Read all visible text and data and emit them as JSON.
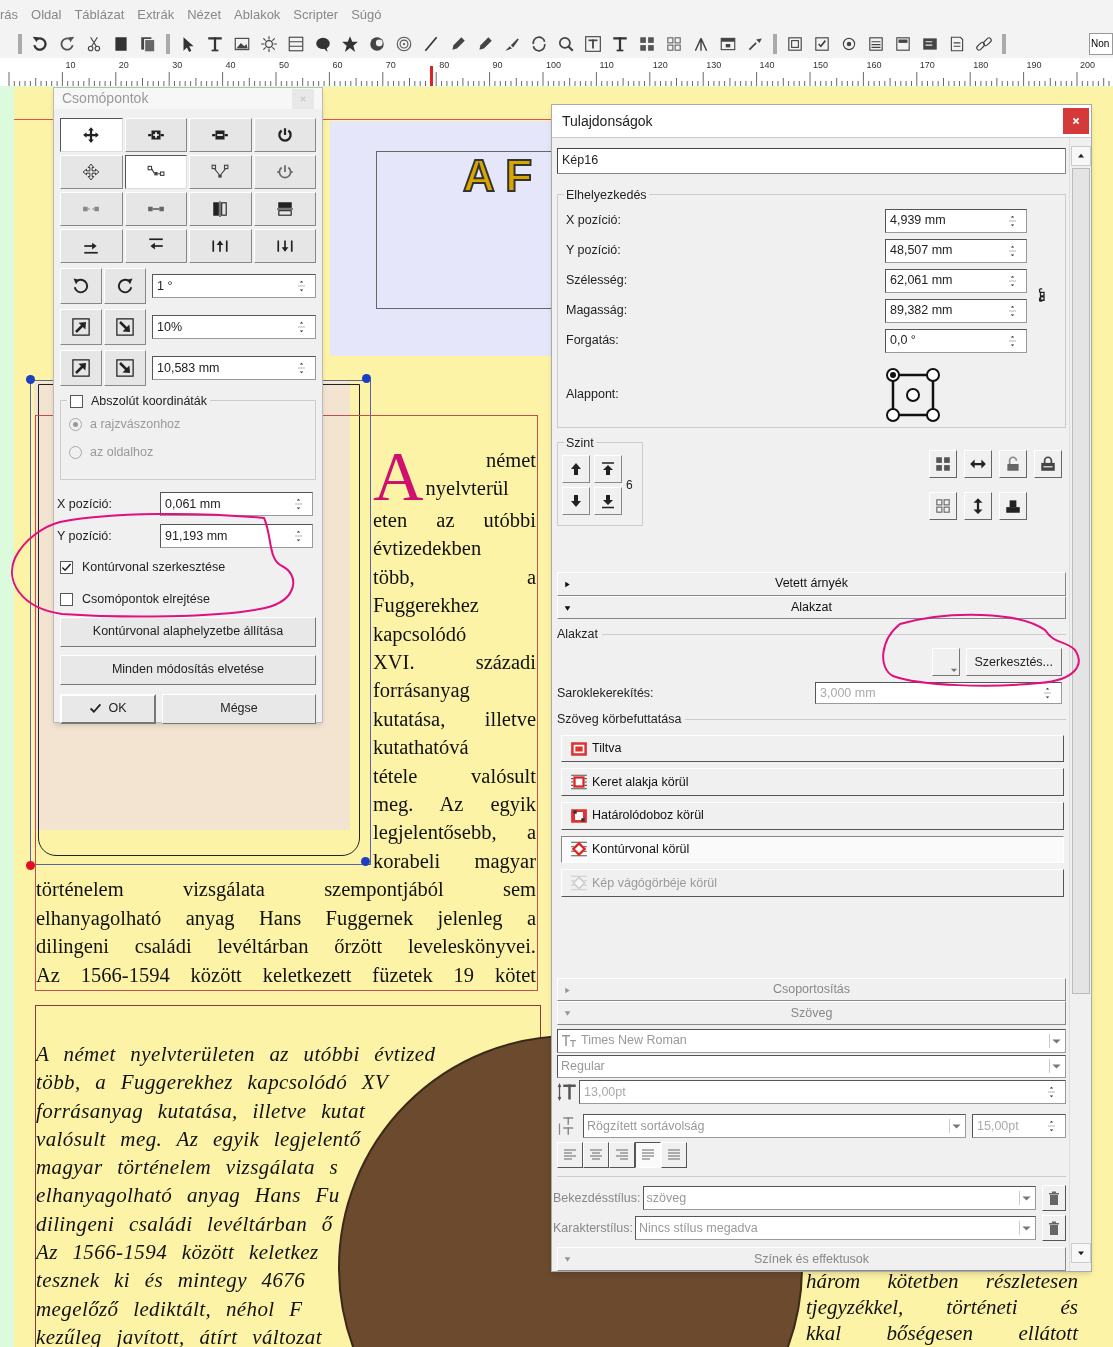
{
  "menu": [
    "rás",
    "Oldal",
    "Táblázat",
    "Extrák",
    "Nézet",
    "Ablakok",
    "Scripter",
    "Súgó"
  ],
  "toolbar_field": "Non",
  "ruler": [
    "10",
    "20",
    "30",
    "40",
    "50",
    "60",
    "70",
    "80",
    "90",
    "100",
    "110",
    "120",
    "130",
    "140",
    "150",
    "160",
    "170",
    "180",
    "190",
    "200"
  ],
  "document": {
    "header_title": "A F",
    "drop_cap": "A",
    "column_lines": [
      "német",
      "nyelvterül",
      "eten az utóbbi",
      "évtizedekben",
      "több, a",
      "Fuggerekhez",
      "kapcsolódó",
      "XVI. századi",
      "forrásanyag",
      "kutatása, illetve",
      "kutathatóvá",
      "tétele valósult",
      "meg. Az egyik",
      "legjelentősebb, a",
      "korabeli magyar"
    ],
    "full_lines": [
      "történelem vizsgálata szempontjából sem",
      "elhanyagolható anyag Hans Fuggernek jelenleg a",
      "dilingeni családi levéltárban őrzött leveleskönyvei.",
      "Az 1566-1594 között keletkezett füzetek 19 kötet"
    ],
    "italic_lines": [
      "A német nyelvterületen az utóbbi évtized",
      "több, a Fuggerekhez kapcsolódó XV",
      "forrásanyag kutatása, illetve kutat",
      "valósult meg. Az egyik legjelentő",
      "magyar történelem vizsgálata s",
      "elhanyagolható anyag Hans Fu",
      "dilingeni családi levéltárban ő",
      "Az 1566-1594 között keletkez",
      "tesznek ki és mintegy 4676",
      "megelőző lediktált, néhol F",
      "kezűleg javított, átírt változat"
    ],
    "right_lines": [
      "három kötetben részletesen",
      "tjegyzékkel, történeti és",
      "kkal bőségesen ellátott"
    ]
  },
  "nodes_dialog": {
    "title": "Csomópontok",
    "tools": [
      {
        "selected": true
      },
      {
        "selected": false
      },
      {
        "selected": false
      },
      {
        "selected": false
      },
      {
        "selected": false
      },
      {
        "selected": true
      },
      {
        "selected": false
      },
      {
        "selected": false
      },
      {
        "selected": false
      },
      {
        "selected": false
      },
      {
        "selected": false
      },
      {
        "selected": false
      },
      {
        "selected": false
      },
      {
        "selected": false
      },
      {
        "selected": false
      },
      {
        "selected": false
      }
    ],
    "rotate": "1 °",
    "scale_percent": "10%",
    "scale_length": "10,583 mm",
    "absolute": {
      "label": "Abszolút koordináták",
      "checked": false
    },
    "origin": [
      {
        "label": "a rajzvászonhoz",
        "selected": true,
        "disabled": true
      },
      {
        "label": "az oldalhoz",
        "selected": false,
        "disabled": true
      }
    ],
    "x": {
      "label": "X pozíció:",
      "value": "0,061 mm"
    },
    "y": {
      "label": "Y pozíció:",
      "value": "91,193 mm"
    },
    "options": [
      {
        "label": "Kontúrvonal szerkesztése",
        "checked": true
      },
      {
        "label": "Csomópontok elrejtése",
        "checked": false
      }
    ],
    "buttons": [
      {
        "label": "Kontúrvonal alaphelyzetbe állítása",
        "kind": "wide"
      },
      {
        "label": "Minden módosítás elvetése",
        "kind": "wide"
      },
      {
        "label": "OK",
        "kind": "ok"
      },
      {
        "label": "Mégse",
        "kind": "cancel"
      }
    ]
  },
  "properties": {
    "title": "Tulajdonságok",
    "name": "Kép16",
    "placement": {
      "title": "Elhelyezkedés",
      "fields": [
        {
          "label": "X pozíció:",
          "value": "4,939 mm"
        },
        {
          "label": "Y pozíció:",
          "value": "48,507 mm"
        },
        {
          "label": "Szélesség:",
          "value": "62,061 mm"
        },
        {
          "label": "Magasság:",
          "value": "89,382 mm"
        },
        {
          "label": "Forgatás:",
          "value": "0,0 °"
        }
      ],
      "anchor_label": "Alappont:",
      "anchor_points": [
        {
          "selected": true
        },
        {
          "selected": false
        },
        {
          "selected": false
        },
        {
          "selected": false
        },
        {
          "selected": false
        }
      ]
    },
    "level": {
      "title": "Szint",
      "value": "6"
    },
    "shadow_header": {
      "label": "Vetett árnyék",
      "expanded": false,
      "disabled": false
    },
    "shape_header": {
      "label": "Alakzat",
      "expanded": true,
      "disabled": false
    },
    "shape": {
      "title": "Alakzat",
      "edit_button": "Szerkesztés...",
      "corner_label": "Saroklekerekítés:",
      "corner_value": "3,000 mm",
      "wrap_title": "Szöveg körbefuttatása",
      "wrap_options": [
        {
          "label": "Tiltva",
          "selected": false,
          "disabled": false
        },
        {
          "label": "Keret alakja körül",
          "selected": false,
          "disabled": false
        },
        {
          "label": "Határolódoboz körül",
          "selected": false,
          "disabled": false
        },
        {
          "label": "Kontúrvonal körül",
          "selected": true,
          "disabled": false
        },
        {
          "label": "Kép vágógörbéje körül",
          "selected": false,
          "disabled": true
        }
      ]
    },
    "group_header": {
      "label": "Csoportosítás",
      "expanded": false,
      "disabled": true
    },
    "text_header": {
      "label": "Szöveg",
      "expanded": true,
      "disabled": true
    },
    "text": {
      "font": "Times New Roman",
      "style": "Regular",
      "size": "13,00pt",
      "spacing_mode": "Rögzített sortávolság",
      "spacing": "15,00pt",
      "alignments": [
        {
          "selected": false
        },
        {
          "selected": false
        },
        {
          "selected": false
        },
        {
          "selected": true
        },
        {
          "selected": false
        }
      ],
      "paragraph_label": "Bekezdésstílus:",
      "paragraph_style": "szöveg",
      "char_label": "Karakterstílus:",
      "char_style": "Nincs stílus megadva"
    },
    "colors_header": {
      "label": "Színek és effektusok",
      "expanded": true,
      "disabled": true
    }
  }
}
